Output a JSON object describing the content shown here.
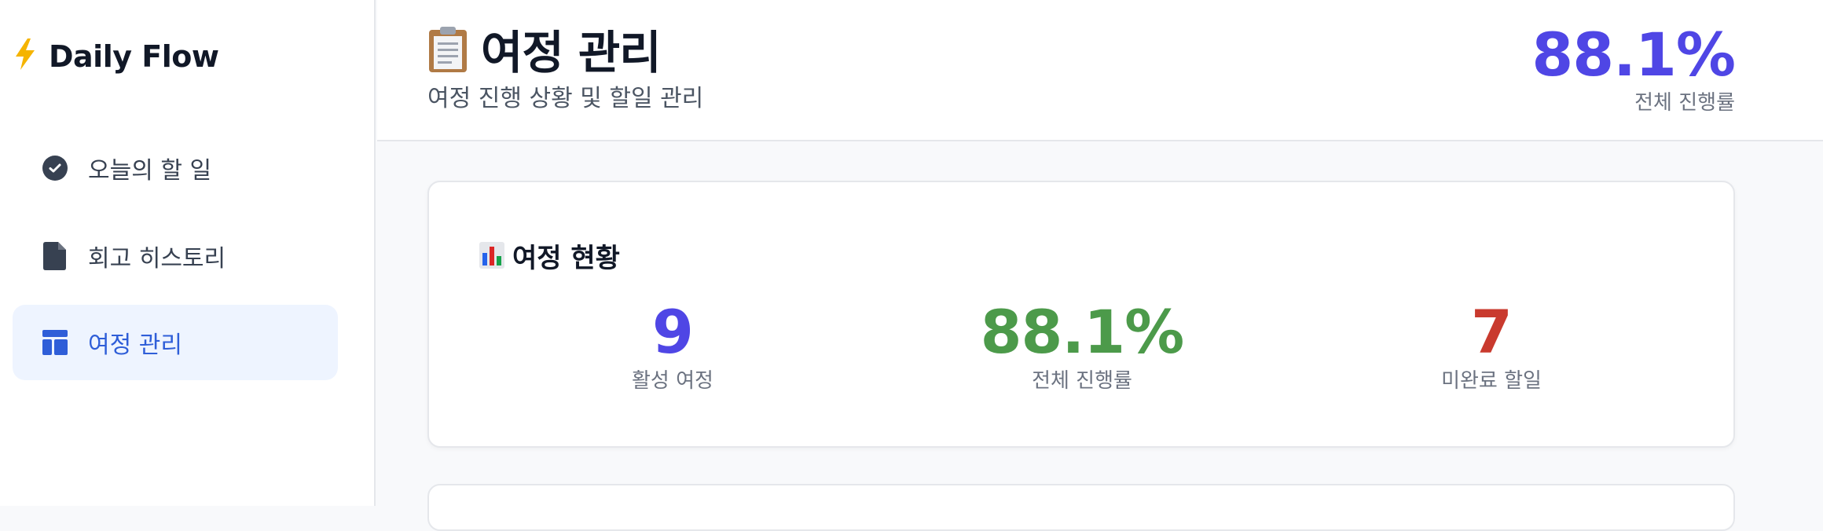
{
  "app": {
    "brand_icon": "lightning-bolt-icon",
    "brand_name": "Daily Flow"
  },
  "sidebar": {
    "items": [
      {
        "label": "오늘의 할 일",
        "icon": "check-circle-icon",
        "active": false
      },
      {
        "label": "회고 히스토리",
        "icon": "document-icon",
        "active": false
      },
      {
        "label": "여정 관리",
        "icon": "layout-icon",
        "active": true
      }
    ]
  },
  "header": {
    "title": "여정 관리",
    "title_icon": "clipboard-icon",
    "subtitle": "여정 진행 상황 및 할일 관리",
    "stat_value": "88.1%",
    "stat_label": "전체 진행률"
  },
  "overview": {
    "title": "여정 현황",
    "title_icon": "bar-chart-icon",
    "stats": [
      {
        "value": "9",
        "label": "활성 여정",
        "color": "#4f46e5"
      },
      {
        "value": "88.1%",
        "label": "전체 진행률",
        "color": "#4c9a4a"
      },
      {
        "value": "7",
        "label": "미완료 할일",
        "color": "#c93a2e"
      }
    ]
  },
  "colors": {
    "accent": "#4f46e5",
    "active_nav_bg": "#eef4ff",
    "active_nav_text": "#2f5ed8",
    "success": "#4c9a4a",
    "danger": "#c93a2e"
  }
}
